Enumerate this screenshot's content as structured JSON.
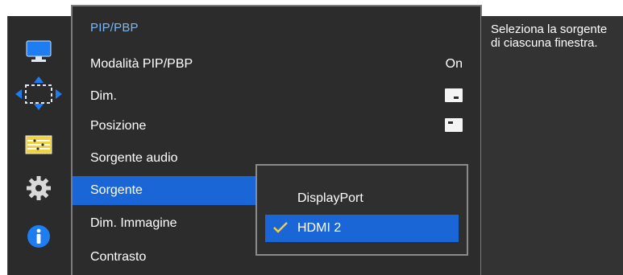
{
  "colors": {
    "accent": "#1b66d6",
    "title": "#7ab8f5",
    "panel_bg": "#2c2c2c"
  },
  "rail": {
    "icons": [
      "monitor-icon",
      "screen-size-icon",
      "pip-pbp-icon",
      "gear-icon",
      "info-icon"
    ]
  },
  "menu": {
    "title": "PIP/PBP",
    "items": [
      {
        "label": "Modalità PIP/PBP",
        "value": "On"
      },
      {
        "label": "Dim.",
        "value_icon": "size-icon"
      },
      {
        "label": "Posizione",
        "value_icon": "position-icon"
      },
      {
        "label": "Sorgente audio"
      },
      {
        "label": "Sorgente",
        "selected": true
      },
      {
        "label": "Dim. Immagine"
      },
      {
        "label": "Contrasto"
      }
    ]
  },
  "submenu": {
    "options": [
      {
        "label": "DisplayPort"
      },
      {
        "label": "HDMI 2",
        "selected": true,
        "icon": "check-icon"
      }
    ]
  },
  "help": {
    "text": "Seleziona la sorgente di ciascuna finestra."
  }
}
